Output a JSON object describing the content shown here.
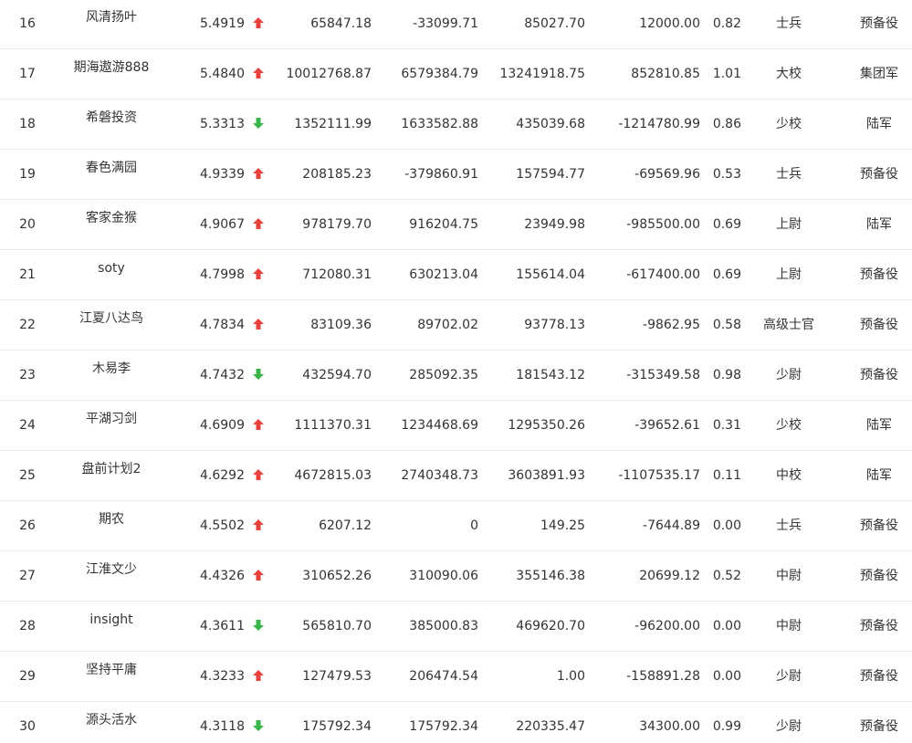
{
  "colors": {
    "up": "#e8413c",
    "down": "#3ab54a",
    "border": "#ececec",
    "text": "#333333"
  },
  "rows": [
    {
      "rank": "16",
      "name": "风清扬叶",
      "score": "5.4919",
      "trend": "up",
      "v1": "65847.18",
      "v2": "-33099.71",
      "v3": "85027.70",
      "v4": "12000.00",
      "v5": "0.82",
      "rank_name": "士兵",
      "army": "预备役"
    },
    {
      "rank": "17",
      "name": "期海遨游888",
      "score": "5.4840",
      "trend": "up",
      "v1": "10012768.87",
      "v2": "6579384.79",
      "v3": "13241918.75",
      "v4": "852810.85",
      "v5": "1.01",
      "rank_name": "大校",
      "army": "集团军"
    },
    {
      "rank": "18",
      "name": "希磐投资",
      "score": "5.3313",
      "trend": "down",
      "v1": "1352111.99",
      "v2": "1633582.88",
      "v3": "435039.68",
      "v4": "-1214780.99",
      "v5": "0.86",
      "rank_name": "少校",
      "army": "陆军"
    },
    {
      "rank": "19",
      "name": "春色满园",
      "score": "4.9339",
      "trend": "up",
      "v1": "208185.23",
      "v2": "-379860.91",
      "v3": "157594.77",
      "v4": "-69569.96",
      "v5": "0.53",
      "rank_name": "士兵",
      "army": "预备役"
    },
    {
      "rank": "20",
      "name": "客家金猴",
      "score": "4.9067",
      "trend": "up",
      "v1": "978179.70",
      "v2": "916204.75",
      "v3": "23949.98",
      "v4": "-985500.00",
      "v5": "0.69",
      "rank_name": "上尉",
      "army": "陆军"
    },
    {
      "rank": "21",
      "name": "soty",
      "score": "4.7998",
      "trend": "up",
      "v1": "712080.31",
      "v2": "630213.04",
      "v3": "155614.04",
      "v4": "-617400.00",
      "v5": "0.69",
      "rank_name": "上尉",
      "army": "预备役"
    },
    {
      "rank": "22",
      "name": "江夏八达鸟",
      "score": "4.7834",
      "trend": "up",
      "v1": "83109.36",
      "v2": "89702.02",
      "v3": "93778.13",
      "v4": "-9862.95",
      "v5": "0.58",
      "rank_name": "高级士官",
      "army": "预备役"
    },
    {
      "rank": "23",
      "name": "木易李",
      "score": "4.7432",
      "trend": "down",
      "v1": "432594.70",
      "v2": "285092.35",
      "v3": "181543.12",
      "v4": "-315349.58",
      "v5": "0.98",
      "rank_name": "少尉",
      "army": "预备役"
    },
    {
      "rank": "24",
      "name": "平湖习剑",
      "score": "4.6909",
      "trend": "up",
      "v1": "1111370.31",
      "v2": "1234468.69",
      "v3": "1295350.26",
      "v4": "-39652.61",
      "v5": "0.31",
      "rank_name": "少校",
      "army": "陆军"
    },
    {
      "rank": "25",
      "name": "盘前计划2",
      "score": "4.6292",
      "trend": "up",
      "v1": "4672815.03",
      "v2": "2740348.73",
      "v3": "3603891.93",
      "v4": "-1107535.17",
      "v5": "0.11",
      "rank_name": "中校",
      "army": "陆军"
    },
    {
      "rank": "26",
      "name": "期农",
      "score": "4.5502",
      "trend": "up",
      "v1": "6207.12",
      "v2": "0",
      "v3": "149.25",
      "v4": "-7644.89",
      "v5": "0.00",
      "rank_name": "士兵",
      "army": "预备役"
    },
    {
      "rank": "27",
      "name": "江淮文少",
      "score": "4.4326",
      "trend": "up",
      "v1": "310652.26",
      "v2": "310090.06",
      "v3": "355146.38",
      "v4": "20699.12",
      "v5": "0.52",
      "rank_name": "中尉",
      "army": "预备役"
    },
    {
      "rank": "28",
      "name": "insight",
      "score": "4.3611",
      "trend": "down",
      "v1": "565810.70",
      "v2": "385000.83",
      "v3": "469620.70",
      "v4": "-96200.00",
      "v5": "0.00",
      "rank_name": "中尉",
      "army": "预备役"
    },
    {
      "rank": "29",
      "name": "坚持平庸",
      "score": "4.3233",
      "trend": "up",
      "v1": "127479.53",
      "v2": "206474.54",
      "v3": "1.00",
      "v4": "-158891.28",
      "v5": "0.00",
      "rank_name": "少尉",
      "army": "预备役"
    },
    {
      "rank": "30",
      "name": "源头活水",
      "score": "4.3118",
      "trend": "down",
      "v1": "175792.34",
      "v2": "175792.34",
      "v3": "220335.47",
      "v4": "34300.00",
      "v5": "0.99",
      "rank_name": "少尉",
      "army": "预备役"
    }
  ]
}
